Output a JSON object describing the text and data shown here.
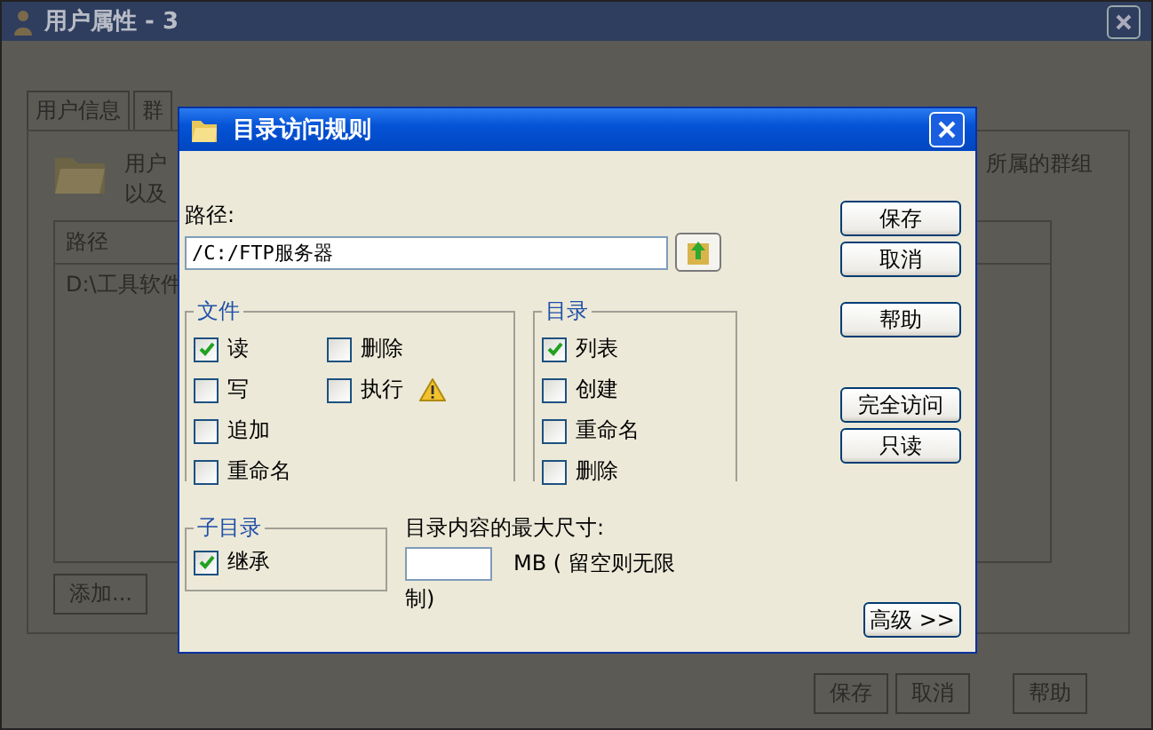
{
  "window": {
    "title": "用户属性 - 3"
  },
  "tabs": [
    {
      "label": "用户信息",
      "selected": false
    },
    {
      "label": "群",
      "selected": false
    }
  ],
  "description": {
    "line_1": "用户",
    "line_2": "以及",
    "right_text": "所属的群组"
  },
  "table": {
    "columns": [
      "路径"
    ],
    "rows": [
      "D:\\工具软件"
    ]
  },
  "panel_buttons": [
    "添加..."
  ],
  "footer_buttons": [
    "保存",
    "取消",
    "帮助"
  ],
  "dialog": {
    "title": "目录访问规则",
    "path_label": "路径:",
    "path_value": "/C:/FTP服务器",
    "files": {
      "title": "文件",
      "items": [
        {
          "label": "读",
          "checked": true,
          "warning": false
        },
        {
          "label": "写",
          "checked": false,
          "warning": false
        },
        {
          "label": "追加",
          "checked": false,
          "warning": false
        },
        {
          "label": "重命名",
          "checked": false,
          "warning": false
        },
        {
          "label": "删除",
          "checked": false,
          "warning": false
        },
        {
          "label": "执行",
          "checked": false,
          "warning": true
        }
      ]
    },
    "dirs": {
      "title": "目录",
      "items": [
        {
          "label": "列表",
          "checked": true
        },
        {
          "label": "创建",
          "checked": false
        },
        {
          "label": "重命名",
          "checked": false
        },
        {
          "label": "删除",
          "checked": false
        }
      ]
    },
    "subdirs": {
      "title": "子目录",
      "items": [
        {
          "label": "继承",
          "checked": true
        }
      ]
    },
    "max_size_label": "目录内容的最大尺寸:",
    "max_size_hint_1": "MB ( 留空则无限",
    "max_size_hint_2": "制)",
    "side_button_groups": [
      [
        "保存",
        "取消"
      ],
      [
        "帮助"
      ],
      [
        "完全访问",
        "只读"
      ]
    ],
    "advanced_button": "高级 >>"
  }
}
